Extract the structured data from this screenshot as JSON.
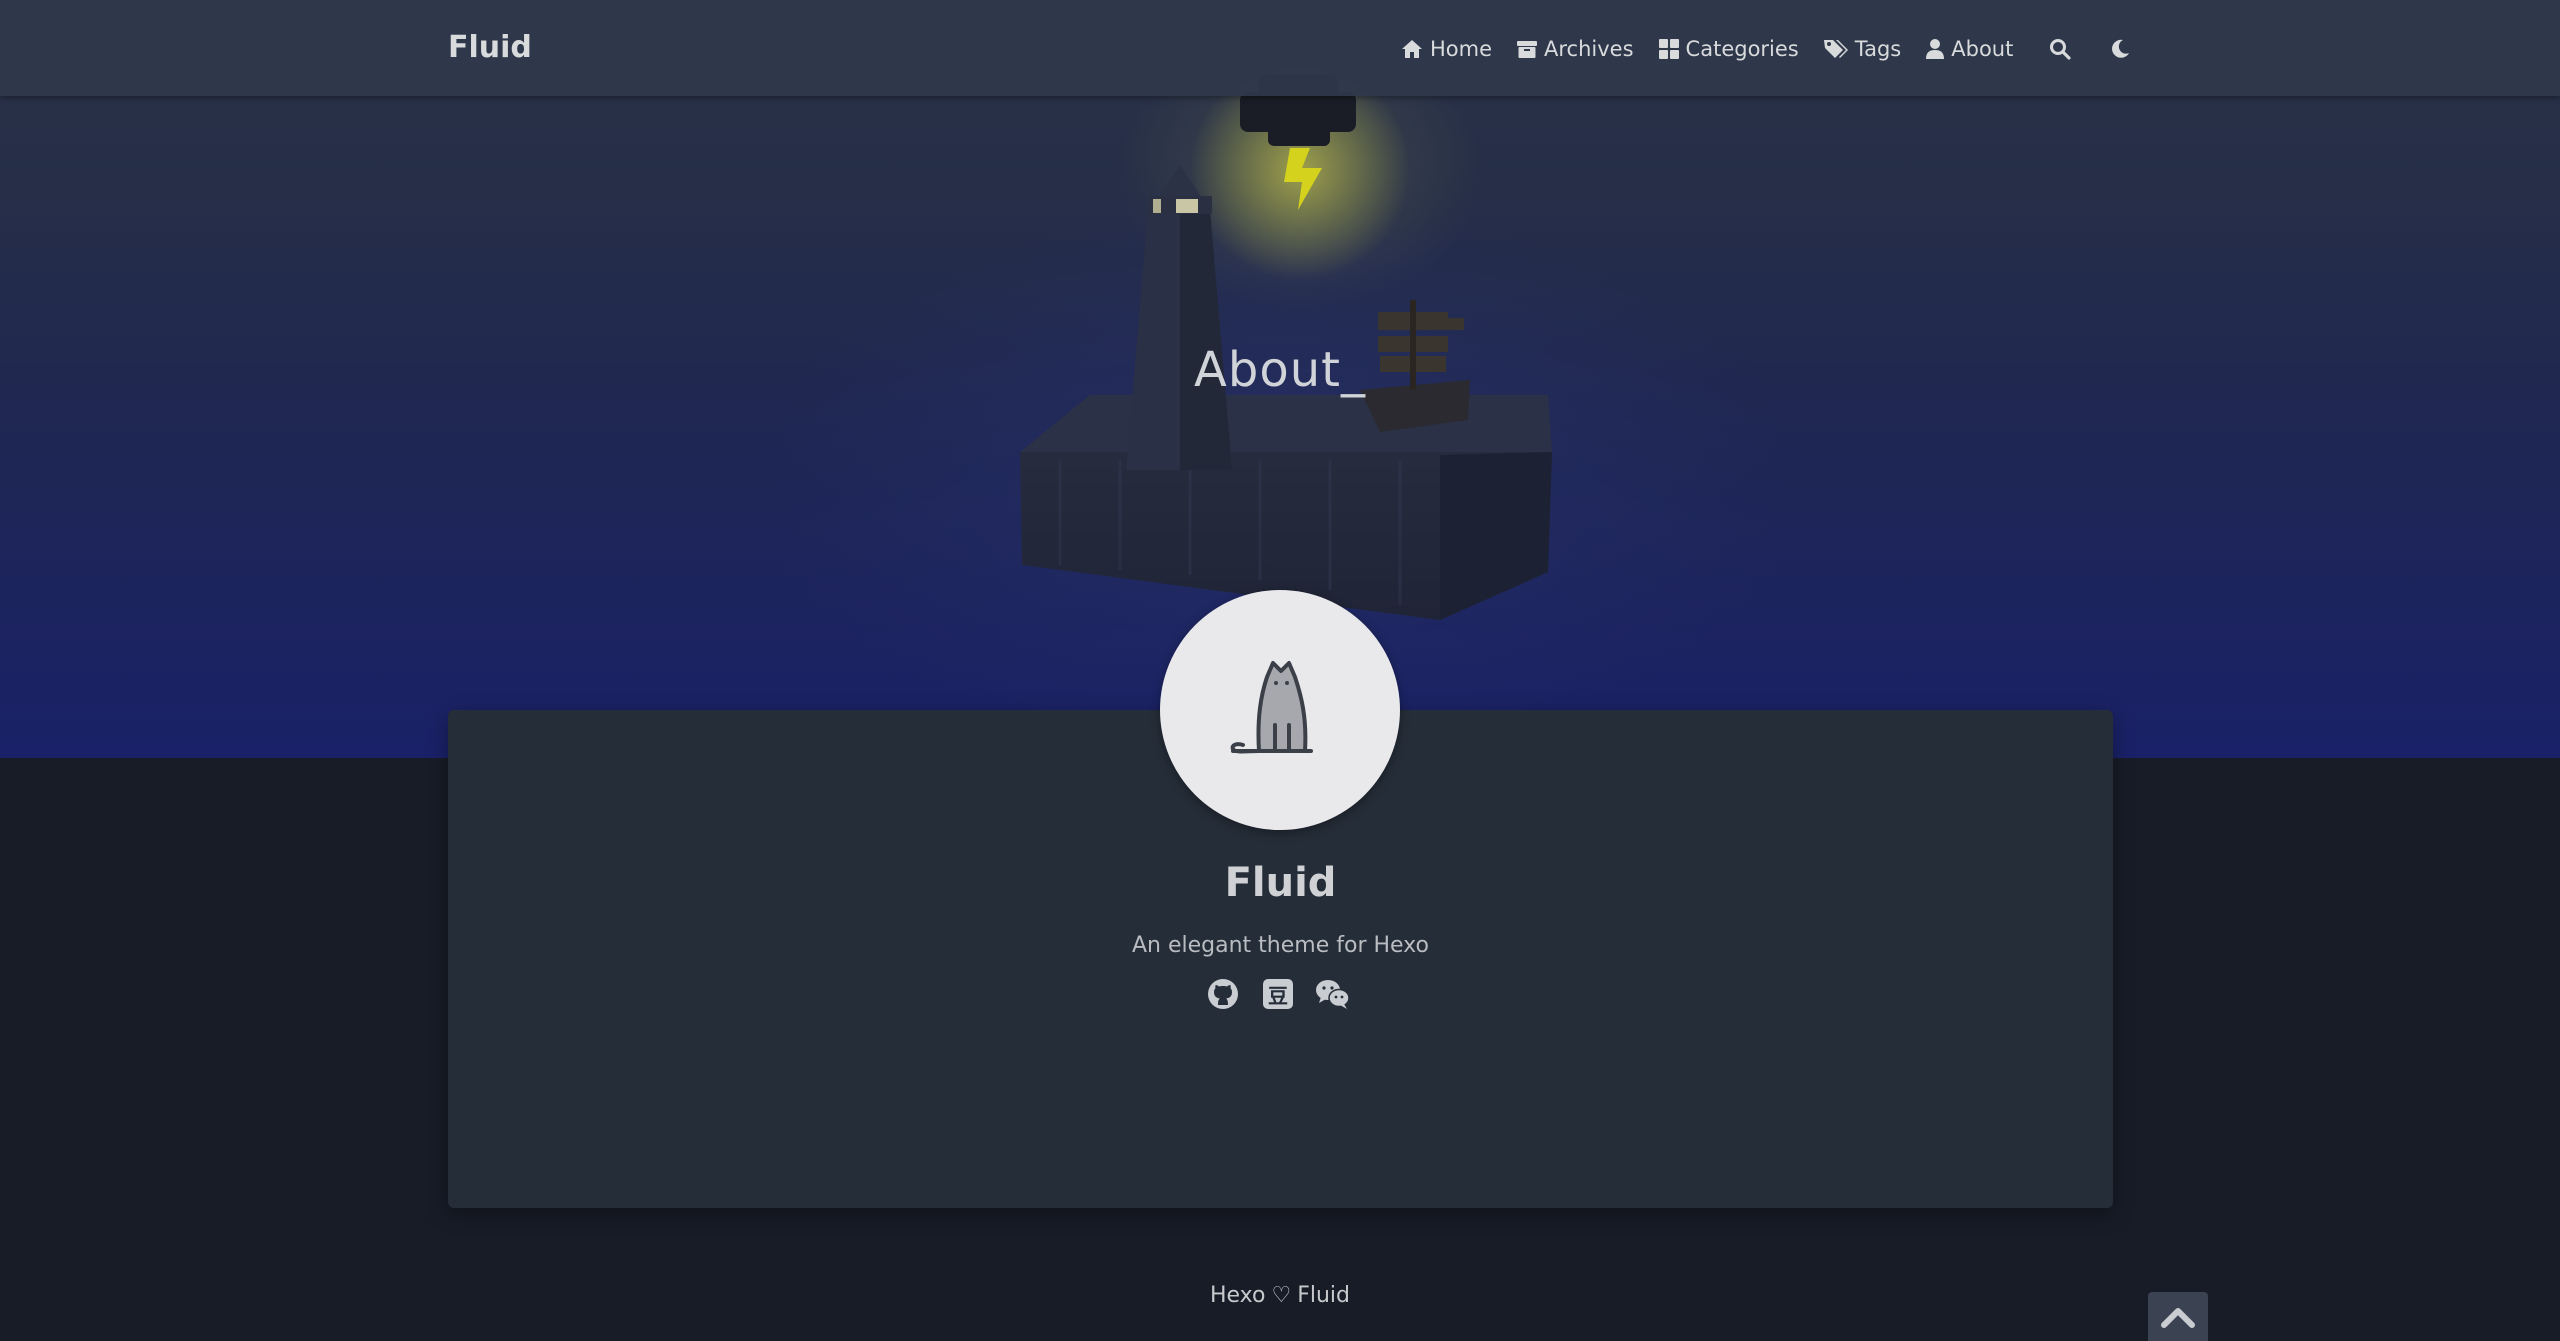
{
  "navbar": {
    "brand": "Fluid",
    "items": [
      {
        "label": "Home",
        "icon": "home-icon"
      },
      {
        "label": "Archives",
        "icon": "archive-icon"
      },
      {
        "label": "Categories",
        "icon": "categories-icon"
      },
      {
        "label": "Tags",
        "icon": "tags-icon"
      },
      {
        "label": "About",
        "icon": "user-icon"
      }
    ],
    "search_icon": "search-icon",
    "theme_icon": "moon-icon"
  },
  "banner": {
    "title": "About",
    "cursor": "_"
  },
  "profile": {
    "avatar_icon": "cat-avatar-icon",
    "name": "Fluid",
    "intro": "An elegant theme for Hexo",
    "social": [
      {
        "icon": "github-icon"
      },
      {
        "icon": "douban-icon",
        "glyph": "豆"
      },
      {
        "icon": "wechat-icon"
      }
    ]
  },
  "footer": {
    "left": "Hexo",
    "heart": "♡",
    "right": "Fluid"
  },
  "colors": {
    "page_bg": "#181c27",
    "navbar_bg": "#2f384a",
    "board_bg": "#252d38",
    "lightning": "#d4d21c"
  }
}
